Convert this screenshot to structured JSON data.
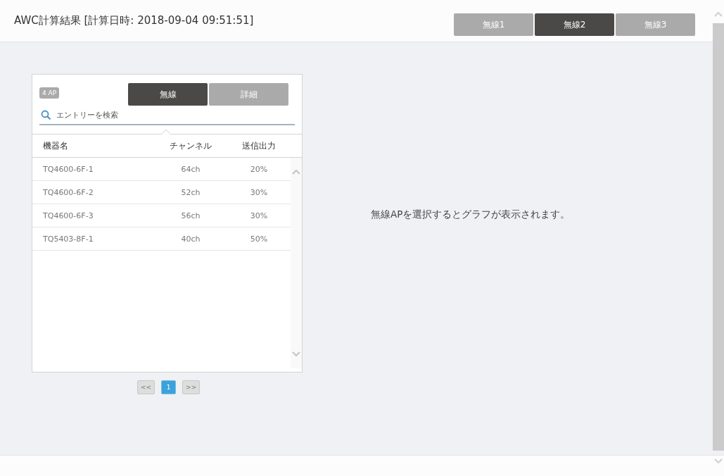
{
  "header": {
    "title": "AWC計算結果 [計算日時: 2018-09-04 09:51:51]",
    "tabs": [
      {
        "label": "無線1",
        "selected": false
      },
      {
        "label": "無線2",
        "selected": true
      },
      {
        "label": "無線3",
        "selected": false
      }
    ]
  },
  "panel": {
    "count_badge": "4 AP",
    "tabs": [
      {
        "label": "無線",
        "selected": true
      },
      {
        "label": "詳細",
        "selected": false
      }
    ],
    "search": {
      "placeholder": "エントリーを検索"
    },
    "columns": [
      "機器名",
      "チャンネル",
      "送信出力"
    ],
    "rows": [
      [
        "TQ4600-6F-1",
        "64ch",
        "20%"
      ],
      [
        "TQ4600-6F-2",
        "52ch",
        "30%"
      ],
      [
        "TQ4600-6F-3",
        "56ch",
        "30%"
      ],
      [
        "TQ5403-8F-1",
        "40ch",
        "50%"
      ]
    ],
    "pagination": [
      {
        "label": "<<",
        "selected": false
      },
      {
        "label": "1",
        "selected": true
      },
      {
        "label": ">>",
        "selected": false
      }
    ]
  },
  "message": "無線APを選択するとグラフが表示されます。"
}
